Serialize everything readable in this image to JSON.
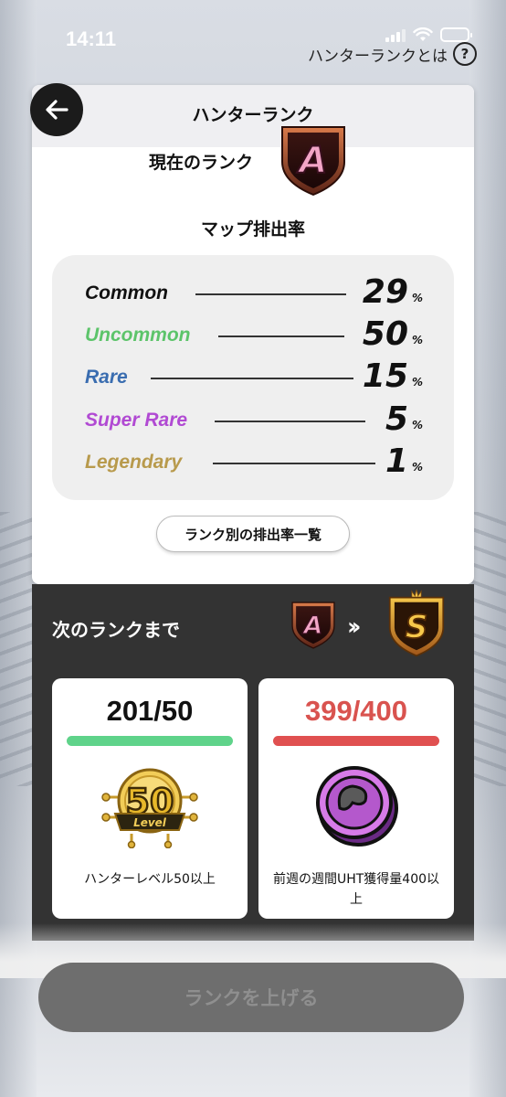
{
  "status_bar": {
    "time": "14:11"
  },
  "header_link": {
    "label": "ハンターランクとは",
    "help_icon": "?"
  },
  "card": {
    "title": "ハンターランク",
    "current_rank_label": "現在のランク",
    "current_rank": "A",
    "map_rate_title": "マップ排出率",
    "rates": [
      {
        "name": "Common",
        "value": "29",
        "unit": "%",
        "color": "#111111"
      },
      {
        "name": "Uncommon",
        "value": "50",
        "unit": "%",
        "color": "#5cc46a"
      },
      {
        "name": "Rare",
        "value": "15",
        "unit": "%",
        "color": "#3a6db0"
      },
      {
        "name": "Super Rare",
        "value": "5",
        "unit": "%",
        "color": "#b14ad3"
      },
      {
        "name": "Legendary",
        "value": "1",
        "unit": "%",
        "color": "#b89a4c"
      }
    ],
    "rank_list_button": "ランク別の排出率一覧"
  },
  "next_rank": {
    "title": "次のランクまで",
    "from_rank": "A",
    "to_rank": "S",
    "requirements": [
      {
        "value": "201/50",
        "value_color": "#111111",
        "bar_color": "#5fd38a",
        "progress": 1.0,
        "icon": "level-50-medal-icon",
        "icon_text": "50",
        "icon_sub": "Level",
        "description": "ハンターレベル50以上"
      },
      {
        "value": "399/400",
        "value_color": "#d9534f",
        "bar_color": "#e05050",
        "progress": 0.9975,
        "icon": "uht-coin-icon",
        "description": "前週の週間UHT獲得量400以上"
      }
    ]
  },
  "cta": {
    "label": "ランクを上げる",
    "enabled": false
  }
}
